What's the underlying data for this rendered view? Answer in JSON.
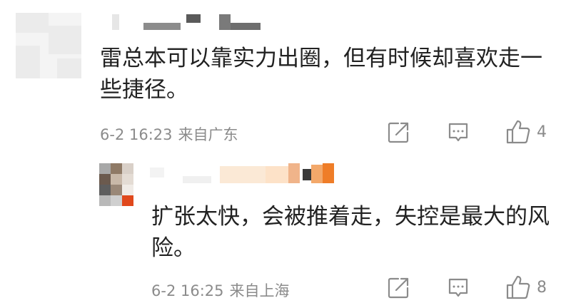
{
  "comment": {
    "text": "雷总本可以靠实力出圈，但有时候却喜欢走一些捷径。",
    "date": "6-2 16:23",
    "location": "来自广东",
    "like_count": "4",
    "icons": {
      "share": "share-icon",
      "reply": "comment-icon",
      "like": "thumbs-up-icon"
    }
  },
  "reply": {
    "text": "扩张太快，会被推着走，失控是最大的风险。",
    "date": "6-2 16:25",
    "location": "来自上海",
    "like_count": "8",
    "icons": {
      "share": "share-icon",
      "reply": "comment-icon",
      "like": "thumbs-up-icon"
    }
  },
  "colors": {
    "text": "#222222",
    "meta": "#8b8b8b",
    "avatar_placeholder": "#ebebeb",
    "reply_avatar_pixels": [
      "#a8a8a8",
      "#8f7a66",
      "#d9d0c8",
      "#6b5a4e",
      "#c8b8a8",
      "#e4dcd4",
      "#5e5e5e",
      "#9a8878",
      "#f0ebe6",
      "#b9b9b9",
      "#cfcfcf",
      "#e0481c"
    ]
  }
}
